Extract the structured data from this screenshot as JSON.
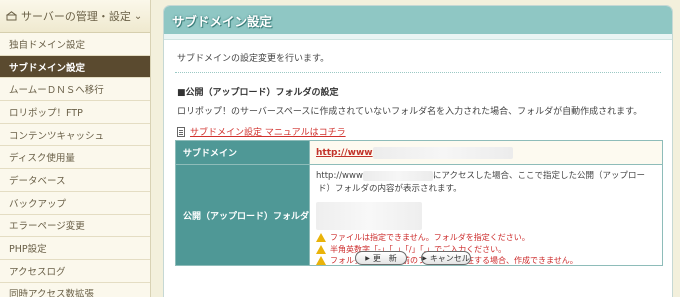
{
  "sidebar": {
    "header": "サーバーの管理・設定",
    "items": [
      {
        "label": "独自ドメイン設定"
      },
      {
        "label": "サブドメイン設定"
      },
      {
        "label": "ムームーＤＮＳへ移行"
      },
      {
        "label": "ロリポップ！FTP"
      },
      {
        "label": "コンテンツキャッシュ"
      },
      {
        "label": "ディスク使用量"
      },
      {
        "label": "データベース"
      },
      {
        "label": "バックアップ"
      },
      {
        "label": "エラーページ変更"
      },
      {
        "label": "PHP設定"
      },
      {
        "label": "アクセスログ"
      },
      {
        "label": "同時アクセス数拡張"
      }
    ],
    "active_index": 1
  },
  "main": {
    "title": "サブドメイン設定",
    "description": "サブドメインの設定変更を行います。",
    "section_heading": "■公開（アップロード）フォルダの設定",
    "section_text": "ロリポップ！のサーバースペースに作成されていないフォルダ名を入力された場合、フォルダが自動作成されます。",
    "manual_link": "サブドメイン設定 マニュアルはコチラ",
    "table": {
      "subdomain_label": "サブドメイン",
      "subdomain_value": "http://www",
      "folder_label": "公開（アップロード）フォルダ",
      "folder_prefix": "http://www",
      "folder_desc_1": "にアクセスした場合、ここで指定した公開（アップロー",
      "folder_desc_2": "ド）フォルダの内容が表示されます。",
      "warnings": [
        "ファイルは指定できません。フォルダを指定ください。",
        "半角英数字「-」「_」「/」「.」でご入力ください。",
        "フォルダ名と同じ名前のファイルが存在する場合、作成できません。"
      ]
    },
    "buttons": {
      "update": "更　新",
      "cancel": "キャンセル"
    }
  },
  "colors": {
    "accent_teal": "#8fc7c4",
    "table_header": "#4f9896",
    "sidebar_active": "#5a4a2f",
    "warning_text": "#cc2b2b",
    "link": "#d0312d"
  }
}
